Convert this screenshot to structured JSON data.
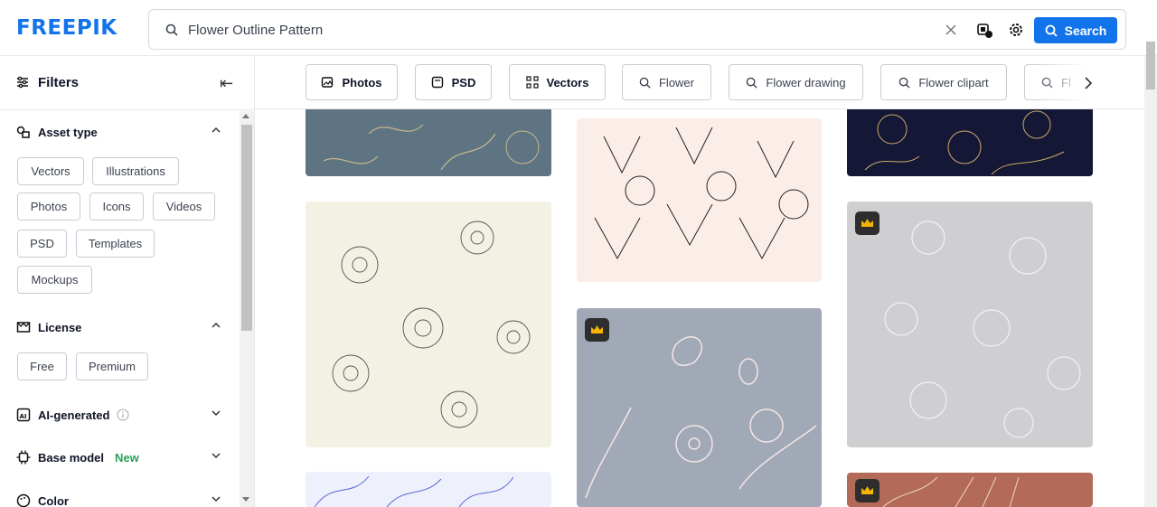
{
  "brand": "FREEPIK",
  "search": {
    "query": "Flower Outline Pattern",
    "button_label": "Search"
  },
  "sidebar": {
    "title": "Filters",
    "asset_type": {
      "label": "Asset type",
      "options": [
        "Vectors",
        "Illustrations",
        "Photos",
        "Icons",
        "Videos",
        "PSD",
        "Templates",
        "Mockups"
      ]
    },
    "license": {
      "label": "License",
      "options": [
        "Free",
        "Premium"
      ]
    },
    "ai_generated": {
      "label": "AI-generated"
    },
    "base_model": {
      "label": "Base model",
      "badge": "New"
    },
    "color": {
      "label": "Color"
    }
  },
  "tags": [
    {
      "label": "Photos",
      "icon": "image-icon"
    },
    {
      "label": "PSD",
      "icon": "psd-icon"
    },
    {
      "label": "Vectors",
      "icon": "vector-icon"
    },
    {
      "label": "Flower",
      "icon": "search-icon"
    },
    {
      "label": "Flower drawing",
      "icon": "search-icon"
    },
    {
      "label": "Flower clipart",
      "icon": "search-icon"
    },
    {
      "label": "Fl",
      "icon": "search-icon"
    }
  ],
  "results": [
    {
      "name": "slate-floral-outline",
      "color": "#5f7483",
      "premium": false
    },
    {
      "name": "daffodil-sketch-cream",
      "color": "#f3f0e4",
      "premium": false
    },
    {
      "name": "blue-leaf-outline",
      "color": "#eef0fb",
      "premium": false
    },
    {
      "name": "pink-lily-line-art",
      "color": "#fbeee9",
      "premium": false
    },
    {
      "name": "cherry-blossom-grey-blue",
      "color": "#a2a9b6",
      "premium": true
    },
    {
      "name": "gold-floral-navy",
      "color": "#141735",
      "premium": false
    },
    {
      "name": "white-blossom-grey",
      "color": "#cfcfd1",
      "premium": true
    },
    {
      "name": "terracotta-floral-line",
      "color": "#b46a58",
      "premium": true
    }
  ],
  "colors": {
    "brand_blue": "#1273eb",
    "new_green": "#2da05a"
  }
}
